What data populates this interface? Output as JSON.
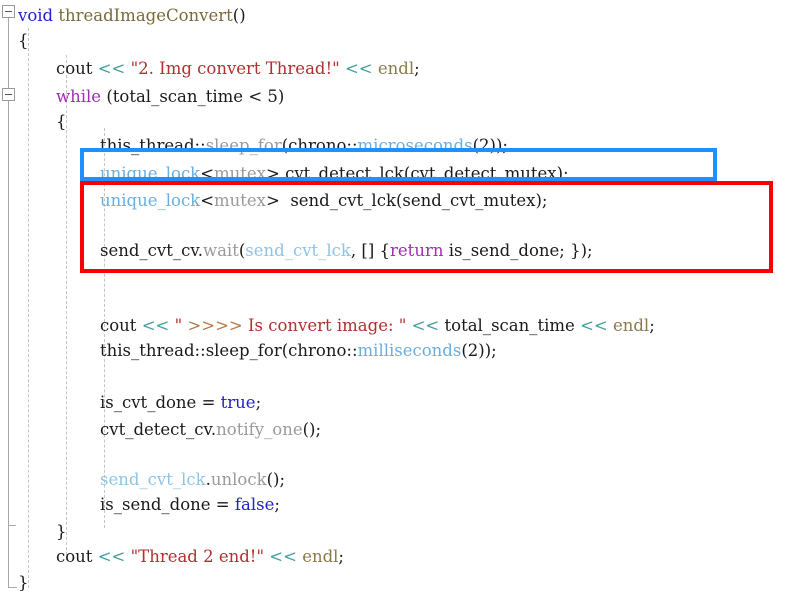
{
  "editor": {
    "language": "cpp",
    "background_color": "#ffffff",
    "default_text_color": "#1a1a1a",
    "font_size_px": 16.5,
    "line_height_px": 25
  },
  "palette": {
    "keyword": "#2222cc",
    "control_keyword": "#9b30b0",
    "function_name": "#7a6a3a",
    "string": "#b03030",
    "string_arrows": "#b5794f",
    "stream_operator": "#3f9f9f",
    "type": "#6aaee0",
    "variable_light_blue": "#8fc4e8",
    "member_function": "#9a9a9a",
    "endl": "#8a7a4a",
    "fold_marker": "#9a9a9a",
    "indent_guide": "#c4c4c4"
  },
  "gutter": {
    "fold_markers": [
      {
        "name": "fold-function-body",
        "state": "expanded",
        "glyph": "−"
      },
      {
        "name": "fold-while-body",
        "state": "expanded",
        "glyph": "−"
      }
    ]
  },
  "annotations": {
    "blue_box": {
      "color": "#1e90ff",
      "label": "cvt-detect-lock-highlight",
      "covers_line": "unique_lock<mutex> cvt_detect_lck(cvt_detect_mutex);"
    },
    "red_box": {
      "color": "#fb0000",
      "label": "send-cvt-wait-highlight",
      "covers_lines": [
        "unique_lock<mutex>  send_cvt_lck(send_cvt_mutex);",
        "send_cvt_cv.wait(send_cvt_lck, [] {return is_send_done; });"
      ]
    }
  },
  "code": {
    "lines": [
      {
        "n": 1,
        "text": "void threadImageConvert()",
        "tokens": [
          {
            "t": "void",
            "c": "kw"
          },
          {
            "t": " ",
            "c": "plain"
          },
          {
            "t": "threadImageConvert",
            "c": "fnname"
          },
          {
            "t": "()",
            "c": "plain"
          }
        ]
      },
      {
        "n": 2,
        "text": "{",
        "tokens": [
          {
            "t": "{",
            "c": "plain"
          }
        ]
      },
      {
        "n": 3,
        "text": "cout << \"2. Img convert Thread!\" << endl;",
        "tokens": [
          {
            "t": "cout ",
            "c": "plain"
          },
          {
            "t": "<<",
            "c": "op"
          },
          {
            "t": " ",
            "c": "plain"
          },
          {
            "t": "\"2. Img convert Thread!\"",
            "c": "str"
          },
          {
            "t": " ",
            "c": "plain"
          },
          {
            "t": "<<",
            "c": "op"
          },
          {
            "t": " ",
            "c": "plain"
          },
          {
            "t": "endl",
            "c": "endl"
          },
          {
            "t": ";",
            "c": "plain"
          }
        ]
      },
      {
        "n": 4,
        "text": "while (total_scan_time < 5)",
        "tokens": [
          {
            "t": "while",
            "c": "kwctl"
          },
          {
            "t": " (total_scan_time ",
            "c": "plain"
          },
          {
            "t": "<",
            "c": "plain"
          },
          {
            "t": " 5)",
            "c": "plain"
          }
        ]
      },
      {
        "n": 5,
        "text": "{",
        "tokens": [
          {
            "t": "{",
            "c": "plain"
          }
        ]
      },
      {
        "n": 6,
        "text": "this_thread::sleep_for(chrono::microseconds(2));",
        "tokens": [
          {
            "t": "this_thread::",
            "c": "plain"
          },
          {
            "t": "sleep_for",
            "c": "mem"
          },
          {
            "t": "(chrono::",
            "c": "plain"
          },
          {
            "t": "microseconds",
            "c": "type"
          },
          {
            "t": "(2));",
            "c": "plain"
          }
        ]
      },
      {
        "n": 7,
        "text": "unique_lock<mutex> cvt_detect_lck(cvt_detect_mutex);",
        "tokens": [
          {
            "t": "unique_lock",
            "c": "type"
          },
          {
            "t": "<",
            "c": "plain"
          },
          {
            "t": "mutex",
            "c": "mutex"
          },
          {
            "t": ">",
            "c": "plain"
          },
          {
            "t": " cvt_detect_lck(cvt_detect_mutex);",
            "c": "plain"
          }
        ]
      },
      {
        "n": 8,
        "text": "unique_lock<mutex>  send_cvt_lck(send_cvt_mutex);",
        "tokens": [
          {
            "t": "unique_lock",
            "c": "type"
          },
          {
            "t": "<",
            "c": "plain"
          },
          {
            "t": "mutex",
            "c": "mutex"
          },
          {
            "t": ">",
            "c": "plain"
          },
          {
            "t": "  send_cvt_lck(send_cvt_mutex);",
            "c": "plain"
          }
        ]
      },
      {
        "n": 9,
        "text": "",
        "tokens": []
      },
      {
        "n": 10,
        "text": "send_cvt_cv.wait(send_cvt_lck, [] {return is_send_done; });",
        "tokens": [
          {
            "t": "send_cvt_cv.",
            "c": "plain"
          },
          {
            "t": "wait",
            "c": "mem"
          },
          {
            "t": "(",
            "c": "plain"
          },
          {
            "t": "send_cvt_lck",
            "c": "var"
          },
          {
            "t": ", [] {",
            "c": "plain"
          },
          {
            "t": "return",
            "c": "kwctl"
          },
          {
            "t": " is_send_done; });",
            "c": "plain"
          }
        ]
      },
      {
        "n": 11,
        "text": "",
        "tokens": []
      },
      {
        "n": 12,
        "text": "",
        "tokens": []
      },
      {
        "n": 13,
        "text": "cout << \" >>>> Is convert image: \" << total_scan_time << endl;",
        "tokens": [
          {
            "t": "cout ",
            "c": "plain"
          },
          {
            "t": "<<",
            "c": "op"
          },
          {
            "t": " ",
            "c": "plain"
          },
          {
            "t": "\" ",
            "c": "str"
          },
          {
            "t": ">>>>",
            "c": "strop"
          },
          {
            "t": " Is convert image: \"",
            "c": "str"
          },
          {
            "t": " ",
            "c": "plain"
          },
          {
            "t": "<<",
            "c": "op"
          },
          {
            "t": " total_scan_time ",
            "c": "plain"
          },
          {
            "t": "<<",
            "c": "op"
          },
          {
            "t": " ",
            "c": "plain"
          },
          {
            "t": "endl",
            "c": "endl"
          },
          {
            "t": ";",
            "c": "plain"
          }
        ]
      },
      {
        "n": 14,
        "text": "this_thread::sleep_for(chrono::milliseconds(2));",
        "tokens": [
          {
            "t": "this_thread::",
            "c": "plain"
          },
          {
            "t": "sleep_for",
            "c": "plain"
          },
          {
            "t": "(chrono::",
            "c": "plain"
          },
          {
            "t": "milliseconds",
            "c": "type"
          },
          {
            "t": "(2));",
            "c": "plain"
          }
        ]
      },
      {
        "n": 15,
        "text": "",
        "tokens": []
      },
      {
        "n": 16,
        "text": "is_cvt_done = true;",
        "tokens": [
          {
            "t": "is_cvt_done = ",
            "c": "plain"
          },
          {
            "t": "true",
            "c": "kw"
          },
          {
            "t": ";",
            "c": "plain"
          }
        ]
      },
      {
        "n": 17,
        "text": "cvt_detect_cv.notify_one();",
        "tokens": [
          {
            "t": "cvt_detect_cv.",
            "c": "plain"
          },
          {
            "t": "notify_one",
            "c": "mem"
          },
          {
            "t": "();",
            "c": "plain"
          }
        ]
      },
      {
        "n": 18,
        "text": "",
        "tokens": []
      },
      {
        "n": 19,
        "text": "",
        "tokens": []
      },
      {
        "n": 20,
        "text": "send_cvt_lck.unlock();",
        "tokens": [
          {
            "t": "send_cvt_lck",
            "c": "var"
          },
          {
            "t": ".",
            "c": "plain"
          },
          {
            "t": "unlock",
            "c": "mem"
          },
          {
            "t": "();",
            "c": "plain"
          }
        ]
      },
      {
        "n": 21,
        "text": "is_send_done = false;",
        "tokens": [
          {
            "t": "is_send_done = ",
            "c": "plain"
          },
          {
            "t": "false",
            "c": "kw"
          },
          {
            "t": ";",
            "c": "plain"
          }
        ]
      },
      {
        "n": 22,
        "text": "}",
        "tokens": [
          {
            "t": "}",
            "c": "plain"
          }
        ]
      },
      {
        "n": 23,
        "text": "cout << \"Thread 2 end!\" << endl;",
        "tokens": [
          {
            "t": "cout ",
            "c": "plain"
          },
          {
            "t": "<<",
            "c": "op"
          },
          {
            "t": " ",
            "c": "plain"
          },
          {
            "t": "\"Thread 2 end!\"",
            "c": "str"
          },
          {
            "t": " ",
            "c": "plain"
          },
          {
            "t": "<<",
            "c": "op"
          },
          {
            "t": " ",
            "c": "plain"
          },
          {
            "t": "endl",
            "c": "endl"
          },
          {
            "t": ";",
            "c": "plain"
          }
        ]
      },
      {
        "n": 24,
        "text": "}",
        "tokens": [
          {
            "t": "}",
            "c": "plain"
          }
        ]
      }
    ]
  }
}
